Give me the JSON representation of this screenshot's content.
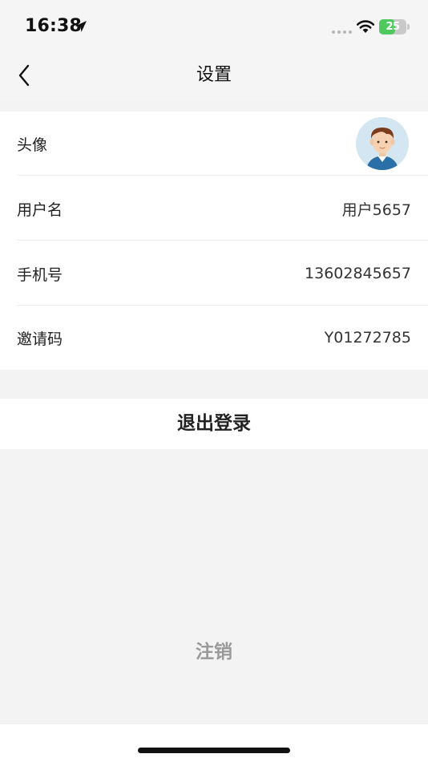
{
  "status_bar": {
    "time": "16:38",
    "battery_level": "25",
    "battery_fraction": 0.6,
    "icons": [
      "location-arrow-icon",
      "signal-dots-icon",
      "wifi-icon",
      "battery-icon"
    ]
  },
  "nav": {
    "title": "设置",
    "back_icon": "chevron-left-icon"
  },
  "settings": {
    "rows": [
      {
        "label": "头像",
        "value": "",
        "icon": "avatar-image"
      },
      {
        "label": "用户名",
        "value": "用户5657"
      },
      {
        "label": "手机号",
        "value": "13602845657"
      },
      {
        "label": "邀请码",
        "value": "Y01272785"
      }
    ]
  },
  "actions": {
    "logout_label": "退出登录",
    "cancel_account_label": "注销"
  },
  "colors": {
    "background": "#f3f3f3",
    "card": "#ffffff",
    "battery_green": "#4fc95e",
    "muted_text": "#9a9a9a"
  }
}
